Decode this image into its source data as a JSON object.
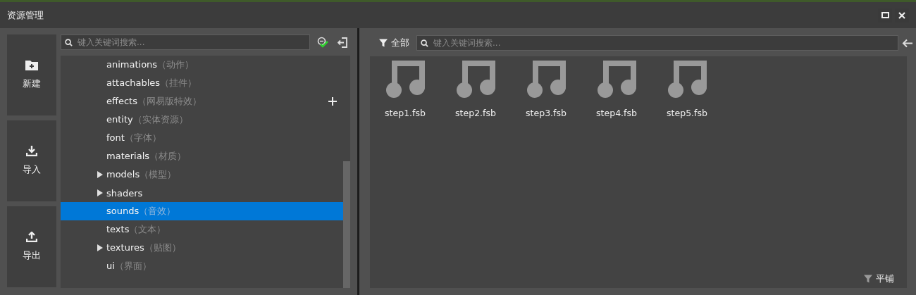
{
  "window": {
    "title": "资源管理"
  },
  "actions": [
    {
      "label": "新建",
      "kind": "new"
    },
    {
      "label": "导入",
      "kind": "import"
    },
    {
      "label": "导出",
      "kind": "export"
    }
  ],
  "tree": {
    "search": {
      "placeholder": "键入关键词搜索..."
    },
    "items": [
      {
        "name": "animations",
        "note": "（动作）",
        "selected": false,
        "hovered": false
      },
      {
        "name": "attachables",
        "note": "（挂件）",
        "selected": false,
        "hovered": false
      },
      {
        "name": "effects",
        "note": "（网易版特效）",
        "selected": false,
        "hovered": true
      },
      {
        "name": "entity",
        "note": "（实体资源）",
        "selected": false,
        "hovered": false
      },
      {
        "name": "font",
        "note": "（字体）",
        "selected": false,
        "hovered": false
      },
      {
        "name": "materials",
        "note": "（材质）",
        "selected": false,
        "hovered": false
      },
      {
        "name": "models",
        "note": "（模型）",
        "selected": false,
        "hovered": false,
        "expanded": false
      },
      {
        "name": "shaders",
        "selected": false,
        "hovered": false,
        "expanded": false
      },
      {
        "name": "sounds",
        "note": "（音效）",
        "selected": true,
        "hovered": false
      },
      {
        "name": "texts",
        "note": "（文本）",
        "selected": false,
        "hovered": false
      },
      {
        "name": "textures",
        "note": "（贴图）",
        "selected": false,
        "hovered": false,
        "expanded": false
      },
      {
        "name": "ui",
        "note": "（界面）",
        "selected": false,
        "hovered": false
      }
    ]
  },
  "assets": {
    "filter": "全部",
    "search": {
      "placeholder": "键入关键词搜索..."
    },
    "files": [
      {
        "name": "step1.fsb",
        "kind": "audio"
      },
      {
        "name": "step2.fsb",
        "kind": "audio"
      },
      {
        "name": "step3.fsb",
        "kind": "audio"
      },
      {
        "name": "step4.fsb",
        "kind": "audio"
      },
      {
        "name": "step5.fsb",
        "kind": "audio"
      }
    ],
    "view_mode": "平铺"
  }
}
